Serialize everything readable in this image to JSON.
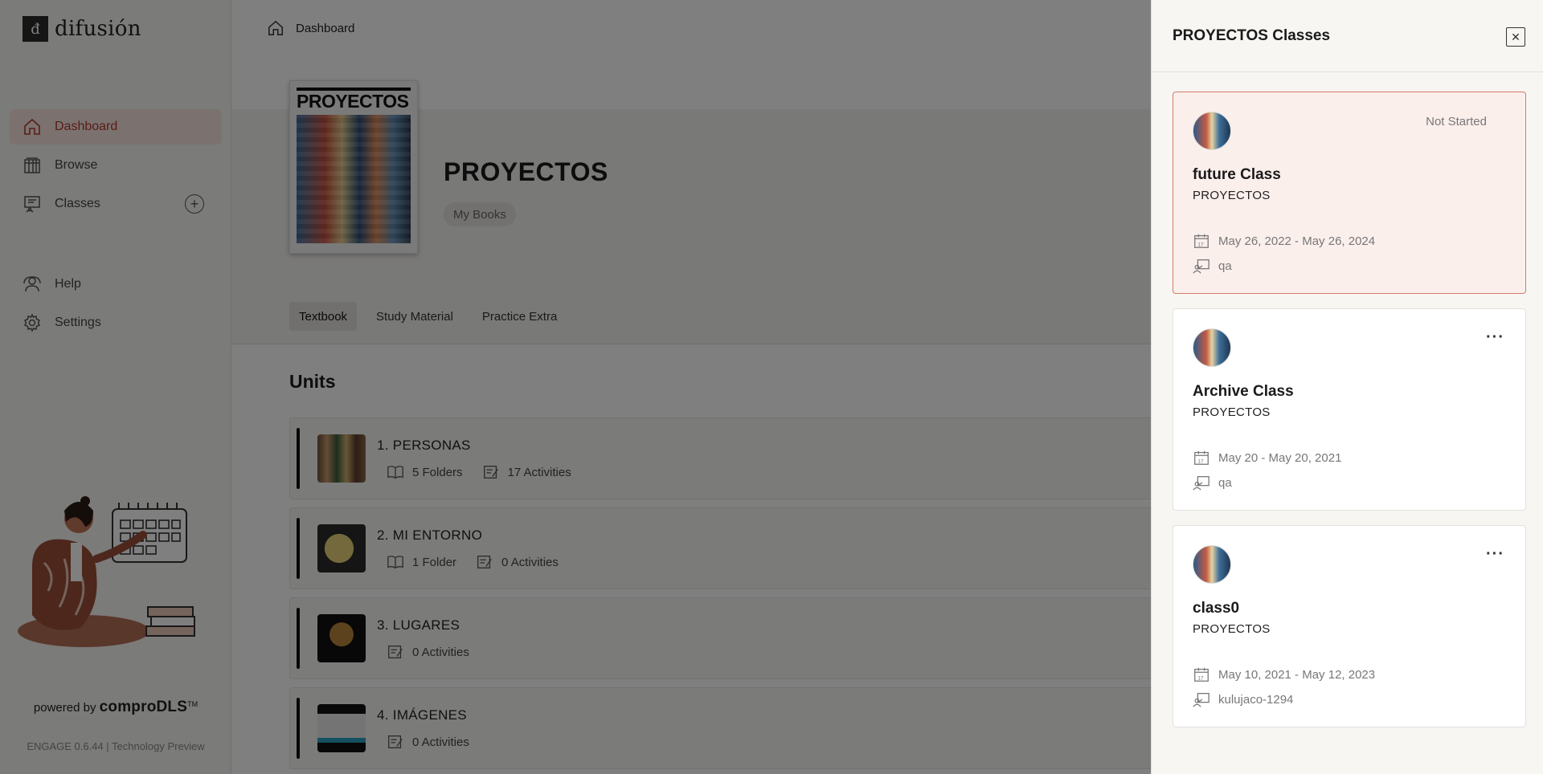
{
  "app": {
    "logo_mark": "đ",
    "logo_text": "difusión"
  },
  "sidebar": {
    "items": [
      {
        "label": "Dashboard",
        "icon": "home-icon",
        "active": true
      },
      {
        "label": "Browse",
        "icon": "books-icon",
        "active": false
      },
      {
        "label": "Classes",
        "icon": "classroom-icon",
        "active": false
      },
      {
        "label": "Help",
        "icon": "help-icon",
        "active": false
      },
      {
        "label": "Settings",
        "icon": "gear-icon",
        "active": false
      }
    ],
    "add_icon": "plus-circle-icon",
    "powered_prefix": "powered by",
    "powered_brand": "comproDLS",
    "powered_tm": "TM",
    "version": "ENGAGE 0.6.44 | Technology Preview"
  },
  "header": {
    "breadcrumb": "Dashboard"
  },
  "book": {
    "cover_title": "PROYECTOS",
    "title": "PROYECTOS",
    "chip": "My Books"
  },
  "tabs": [
    {
      "label": "Textbook",
      "active": true
    },
    {
      "label": "Study Material",
      "active": false
    },
    {
      "label": "Practice Extra",
      "active": false
    }
  ],
  "units": {
    "title": "Units",
    "list": [
      {
        "name": "1.  PERSONAS",
        "folders": "5 Folders",
        "activities": "17 Activities"
      },
      {
        "name": "2.  MI ENTORNO",
        "folders": "1 Folder",
        "activities": "0 Activities"
      },
      {
        "name": "3.  LUGARES",
        "folders": "",
        "activities": "0 Activities"
      },
      {
        "name": "4.  IMÁGENES",
        "folders": "",
        "activities": "0 Activities"
      }
    ]
  },
  "panel": {
    "title": "PROYECTOS Classes",
    "close_icon": "close-icon",
    "classes": [
      {
        "name": "future Class",
        "book": "PROYECTOS",
        "status": "Not Started",
        "dates": "May 26, 2022 - May 26, 2024",
        "teacher": "qa",
        "selected": true
      },
      {
        "name": "Archive Class",
        "book": "PROYECTOS",
        "status": "",
        "dates": "May 20 - May 20, 2021",
        "teacher": "qa",
        "selected": false
      },
      {
        "name": "class0",
        "book": "PROYECTOS",
        "status": "",
        "dates": "May 10, 2021 - May 12, 2023",
        "teacher": "kulujaco-1294",
        "selected": false
      }
    ],
    "more_label": "···"
  },
  "colors": {
    "accent": "#b23a2a",
    "active_bg": "#f6e4e1",
    "selected_card_bg": "#fbefec",
    "selected_card_border": "#d27a6c"
  }
}
